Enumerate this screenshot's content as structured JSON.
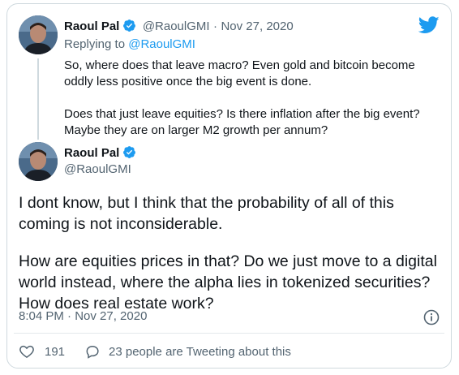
{
  "parent_tweet": {
    "author_name": "Raoul Pal",
    "handle": "@RaoulGMI",
    "separator": "·",
    "date": "Nov 27, 2020",
    "replying_label": "Replying to ",
    "replying_handle": "@RaoulGMI",
    "paragraph1_line1": "So, where does that leave macro? Even gold and bitcoin become",
    "paragraph1_line2": "oddly less positive once the big event is done.",
    "paragraph2_line1": "Does that just leave equities? Is there inflation after the big event?",
    "paragraph2_line2": "Maybe they are on larger M2 growth per annum?"
  },
  "main_tweet": {
    "author_name": "Raoul Pal",
    "handle": "@RaoulGMI",
    "line1": "I dont know, but I think that the probability of all of this",
    "line2": "coming is not inconsiderable.",
    "line3": "How are equities prices in that? Do we just move to a digital",
    "line4": "world instead, where the alpha lies in tokenized securities?",
    "line5": "How does real estate work?",
    "timestamp": "8:04 PM · Nov 27, 2020"
  },
  "actions": {
    "like_count": "191",
    "conversation_text": "23 people are Tweeting about this"
  },
  "icons": {
    "brand": "twitter-bird-icon",
    "verified": "verified-badge-icon",
    "info": "info-icon",
    "like": "heart-icon",
    "reply": "speech-bubble-icon"
  },
  "colors": {
    "accent": "#1d9bf0",
    "muted_text": "#536471",
    "border": "#cfd9de"
  }
}
